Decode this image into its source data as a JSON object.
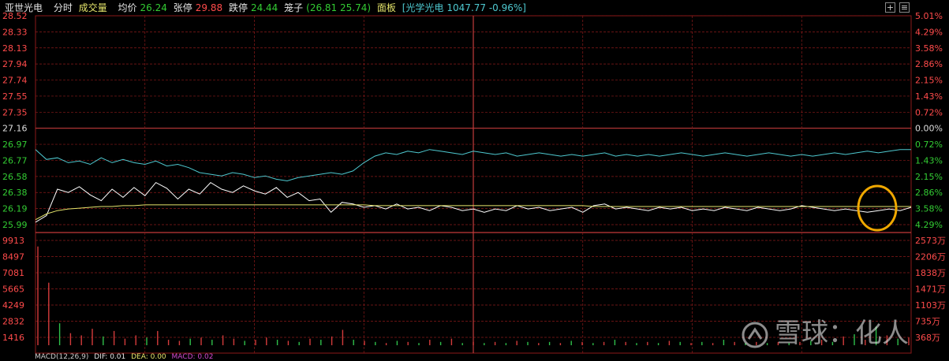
{
  "header": {
    "stock_name": "亚世光电",
    "tab_intraday": "分时",
    "tab_volume": "成交量",
    "avg_label": "均价",
    "avg_value": "26.24",
    "limit_up_label": "张停",
    "limit_up_value": "29.88",
    "limit_down_label": "跌停",
    "limit_down_value": "24.44",
    "cage_label": "笼子",
    "cage_values": "(26.81 25.74)",
    "panel_label": "面板",
    "sector_label": "[光学光电",
    "sector_value": "1047.77 -0.96%]",
    "btn_plus": "+",
    "btn_menu": "≡"
  },
  "colors": {
    "grid": "#8b1a1a",
    "price_line": "#ffffff",
    "avg_line": "#e5e56b",
    "sector_line": "#4ec9d0",
    "volume": "#d33b3b",
    "volume_down": "#2fbf4a",
    "red": "#ff4b4b",
    "green": "#33cc33",
    "highlight": "#f0a800"
  },
  "chart_data": {
    "type": "line",
    "price_axis_left": [
      "28.52",
      "28.33",
      "28.13",
      "27.94",
      "27.74",
      "27.55",
      "27.35",
      "27.16",
      "26.97",
      "26.77",
      "26.58",
      "26.38",
      "26.19",
      "25.99"
    ],
    "pct_axis_right": [
      "5.01%",
      "4.29%",
      "3.58%",
      "2.86%",
      "2.15%",
      "1.43%",
      "0.72%",
      "0.00%",
      "0.72%",
      "1.43%",
      "2.15%",
      "2.86%",
      "3.58%",
      "4.29%"
    ],
    "volume_axis_left": [
      "9913",
      "8497",
      "7081",
      "5665",
      "4249",
      "2832",
      "1416"
    ],
    "volume_axis_right": [
      "2573万",
      "2206万",
      "1838万",
      "1471万",
      "1103万",
      "735万",
      "368万"
    ],
    "price_range": [
      25.99,
      28.52
    ],
    "volume_range": [
      0,
      9913
    ],
    "series": [
      {
        "name": "price",
        "values": [
          26.02,
          26.1,
          26.42,
          26.38,
          26.45,
          26.35,
          26.28,
          26.42,
          26.32,
          26.44,
          26.34,
          26.5,
          26.43,
          26.3,
          26.42,
          26.36,
          26.5,
          26.42,
          26.38,
          26.46,
          26.4,
          26.36,
          26.44,
          26.32,
          26.38,
          26.28,
          26.3,
          26.14,
          26.26,
          26.24,
          26.2,
          26.22,
          26.18,
          26.24,
          26.18,
          26.2,
          26.16,
          26.22,
          26.2,
          26.16,
          26.18,
          26.14,
          26.18,
          26.16,
          26.22,
          26.18,
          26.2,
          26.16,
          26.18,
          26.2,
          26.14,
          26.22,
          26.24,
          26.18,
          26.2,
          26.18,
          26.16,
          26.2,
          26.18,
          26.2,
          26.16,
          26.18,
          26.16,
          26.2,
          26.18,
          26.16,
          26.2,
          26.18,
          26.16,
          26.18,
          26.22,
          26.2,
          26.18,
          26.16,
          26.18,
          26.16,
          26.14,
          26.16,
          26.18,
          26.16,
          26.2
        ]
      },
      {
        "name": "avg",
        "values": [
          26.05,
          26.12,
          26.16,
          26.18,
          26.19,
          26.2,
          26.21,
          26.21,
          26.22,
          26.22,
          26.23,
          26.23,
          26.23,
          26.23,
          26.23,
          26.23,
          26.23,
          26.23,
          26.23,
          26.23,
          26.23,
          26.23,
          26.23,
          26.23,
          26.23,
          26.23,
          26.23,
          26.23,
          26.23,
          26.23,
          26.23,
          26.22,
          26.22,
          26.22,
          26.22,
          26.22,
          26.22,
          26.22,
          26.22,
          26.22,
          26.22,
          26.22,
          26.22,
          26.22,
          26.22,
          26.22,
          26.22,
          26.22,
          26.22,
          26.22,
          26.22,
          26.21,
          26.21,
          26.21,
          26.21,
          26.21,
          26.21,
          26.21,
          26.21,
          26.21,
          26.21,
          26.21,
          26.21,
          26.21,
          26.21,
          26.21,
          26.21,
          26.21,
          26.21,
          26.21,
          26.21,
          26.21,
          26.21,
          26.21,
          26.21,
          26.21,
          26.21,
          26.21,
          26.21,
          26.21,
          26.21
        ]
      },
      {
        "name": "sector",
        "values": [
          26.9,
          26.78,
          26.8,
          26.74,
          26.76,
          26.72,
          26.8,
          26.74,
          26.78,
          26.74,
          26.72,
          26.76,
          26.7,
          26.72,
          26.68,
          26.62,
          26.6,
          26.58,
          26.62,
          26.6,
          26.56,
          26.58,
          26.54,
          26.52,
          26.56,
          26.58,
          26.6,
          26.62,
          26.6,
          26.64,
          26.74,
          26.82,
          26.86,
          26.84,
          26.88,
          26.86,
          26.9,
          26.88,
          26.86,
          26.84,
          26.88,
          26.86,
          26.84,
          26.86,
          26.82,
          26.84,
          26.86,
          26.84,
          26.82,
          26.84,
          26.82,
          26.84,
          26.86,
          26.82,
          26.84,
          26.82,
          26.84,
          26.82,
          26.84,
          26.86,
          26.84,
          26.82,
          26.84,
          26.86,
          26.84,
          26.82,
          26.84,
          26.86,
          26.84,
          26.82,
          26.84,
          26.82,
          26.84,
          26.86,
          26.84,
          26.86,
          26.88,
          26.86,
          26.88,
          26.9,
          26.9
        ]
      }
    ],
    "volume_values": [
      9000,
      5700,
      2000,
      1100,
      900,
      1500,
      800,
      1300,
      600,
      900,
      700,
      1300,
      500,
      400,
      600,
      700,
      500,
      900,
      600,
      400,
      500,
      700,
      500,
      400,
      300,
      600,
      500,
      800,
      1400,
      500,
      400,
      300,
      200,
      400,
      300,
      200,
      500,
      300,
      600,
      200,
      300,
      200,
      300,
      200,
      400,
      300,
      200,
      300,
      200,
      400,
      300,
      200,
      300,
      500,
      300,
      200,
      300,
      200,
      400,
      300,
      200,
      300,
      200,
      500,
      300,
      200,
      300,
      200,
      300,
      200,
      300,
      400,
      500,
      300,
      800,
      1000,
      500,
      1700,
      900,
      600,
      700
    ],
    "volume_colors": [
      "up",
      "up",
      "down",
      "up",
      "up",
      "up",
      "down",
      "up",
      "up",
      "up",
      "down",
      "up",
      "up",
      "up",
      "down",
      "up",
      "down",
      "up",
      "up",
      "down",
      "up",
      "up",
      "down",
      "up",
      "down",
      "up",
      "down",
      "up",
      "up",
      "down",
      "up",
      "down",
      "up",
      "down",
      "up",
      "down",
      "up",
      "down",
      "up",
      "down",
      "up",
      "down",
      "up",
      "down",
      "up",
      "down",
      "up",
      "down",
      "up",
      "down",
      "up",
      "down",
      "up",
      "down",
      "up",
      "down",
      "up",
      "down",
      "up",
      "down",
      "up",
      "down",
      "up",
      "down",
      "up",
      "down",
      "up",
      "down",
      "up",
      "down",
      "up",
      "down",
      "up",
      "down",
      "up",
      "down",
      "up",
      "down",
      "up",
      "down",
      "up"
    ]
  },
  "footer": {
    "macd_label": "MACD(12,26,9)",
    "dif_label": "DIF: 0.01",
    "dea_label": "DEA: 0.00",
    "macd_value": "MACD: 0.02"
  },
  "watermark": {
    "brand": "雪球",
    "author": "化人",
    "separator": "："
  }
}
